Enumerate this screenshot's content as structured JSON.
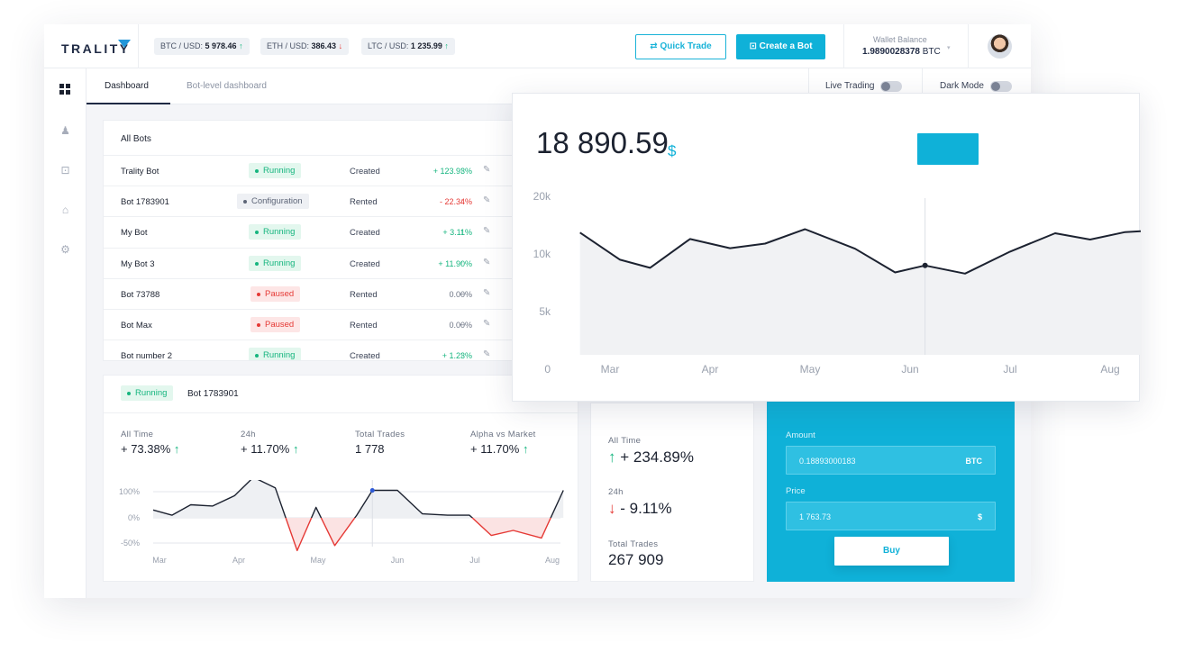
{
  "brand": {
    "name": "TRALITY"
  },
  "tickers": [
    {
      "label": "BTC / USD:",
      "value": "5 978.46",
      "arrow": "↑",
      "dir": "up"
    },
    {
      "label": "ETH / USD:",
      "value": "386.43",
      "arrow": "↓",
      "dir": "down"
    },
    {
      "label": "LTC / USD:",
      "value": "1 235.99",
      "arrow": "↑",
      "dir": "up"
    }
  ],
  "header": {
    "quick_trade_icon": "⇄",
    "quick_trade_label": "Quick Trade",
    "create_bot_icon": "⊡",
    "create_bot_label": "Create a Bot",
    "wallet_label": "Wallet Balance",
    "wallet_value": "1.9890028378",
    "wallet_unit": "BTC",
    "wallet_caret": "▾"
  },
  "sidebar": {
    "items": [
      {
        "name": "dashboard-grid-icon",
        "glyph": ""
      },
      {
        "name": "chess-piece-icon",
        "glyph": "♟"
      },
      {
        "name": "bot-icon",
        "glyph": "⊡"
      },
      {
        "name": "store-icon",
        "glyph": "⌂"
      },
      {
        "name": "settings-icon",
        "glyph": "⚙"
      }
    ]
  },
  "tabs": [
    {
      "label": "Dashboard",
      "active": true
    },
    {
      "label": "Bot-level dashboard",
      "active": false
    }
  ],
  "toggles": [
    {
      "label": "Live Trading"
    },
    {
      "label": "Dark Mode"
    }
  ],
  "bots": {
    "title": "All Bots",
    "edit_glyph": "✎",
    "rows": [
      {
        "name": "Trality Bot",
        "status": "Running",
        "status_key": "running",
        "type": "Created",
        "perf": "+ 123.93%",
        "arrow": "↑",
        "dir": "up"
      },
      {
        "name": "Bot 1783901",
        "status": "Configuration",
        "status_key": "configuration",
        "type": "Rented",
        "perf": "- 22.34%",
        "arrow": "↓",
        "dir": "down"
      },
      {
        "name": "My Bot",
        "status": "Running",
        "status_key": "running",
        "type": "Created",
        "perf": "+ 3.11%",
        "arrow": "↑",
        "dir": "up"
      },
      {
        "name": "My Bot 3",
        "status": "Running",
        "status_key": "running",
        "type": "Created",
        "perf": "+ 11.90%",
        "arrow": "↑",
        "dir": "up"
      },
      {
        "name": "Bot 73788",
        "status": "Paused",
        "status_key": "paused",
        "type": "Rented",
        "perf": "0.00%",
        "arrow": "–",
        "dir": "neutral"
      },
      {
        "name": "Bot Max",
        "status": "Paused",
        "status_key": "paused",
        "type": "Rented",
        "perf": "0.00%",
        "arrow": "–",
        "dir": "neutral"
      },
      {
        "name": "Bot number 2",
        "status": "Running",
        "status_key": "running",
        "type": "Created",
        "perf": "+ 1.23%",
        "arrow": "↑",
        "dir": "up"
      }
    ]
  },
  "detail": {
    "status": "Running",
    "title": "Bot 1783901",
    "stats": [
      {
        "label": "All Time",
        "value": "+ 73.38%",
        "arrow": "↑"
      },
      {
        "label": "24h",
        "value": "+ 11.70%",
        "arrow": "↑"
      },
      {
        "label": "Total Trades",
        "value": "1 778",
        "arrow": ""
      },
      {
        "label": "Alpha vs Market",
        "value": "+ 11.70%",
        "arrow": "↑"
      }
    ]
  },
  "summary": {
    "all_time_label": "All Time",
    "all_time_arrow": "↑",
    "all_time_value": "+ 234.89%",
    "day_label": "24h",
    "day_arrow": "↓",
    "day_value": "- 9.11%",
    "trades_label": "Total Trades",
    "trades_value": "267 909"
  },
  "trade": {
    "amount_label": "Amount",
    "amount_value": "0.18893000183",
    "amount_unit": "BTC",
    "price_label": "Price",
    "price_value": "1 763.73",
    "price_unit": "$",
    "buy_label": "Buy"
  },
  "popup": {
    "price": "18 890.59",
    "unit": "$"
  },
  "colors": {
    "accent": "#0fb1d8",
    "up": "#16b57f",
    "down": "#e53935",
    "line": "#1c2230",
    "area": "#f1f2f4"
  },
  "chart_data": [
    {
      "type": "area",
      "x": [
        "Mar",
        "",
        "Apr",
        "",
        "",
        "May",
        "",
        "",
        "Jun",
        "",
        "",
        "Jul",
        "",
        "",
        "Aug"
      ],
      "categories": [
        "Mar",
        "Apr",
        "May",
        "Jun",
        "Jul",
        "Aug"
      ],
      "yticks": [
        "0",
        "5k",
        "10k",
        "20k"
      ],
      "ylim": [
        0,
        20000
      ],
      "points": [
        [
          -0.3,
          13700
        ],
        [
          0.1,
          9500
        ],
        [
          0.4,
          8800
        ],
        [
          0.8,
          12600
        ],
        [
          1.2,
          11000
        ],
        [
          1.55,
          11800
        ],
        [
          1.95,
          14300
        ],
        [
          2.45,
          10900
        ],
        [
          2.85,
          8400
        ],
        [
          3.15,
          9000
        ],
        [
          3.55,
          8300
        ],
        [
          4.0,
          10400
        ],
        [
          4.45,
          13600
        ],
        [
          4.8,
          12500
        ],
        [
          5.15,
          13800
        ],
        [
          5.6,
          14200
        ],
        [
          6.0,
          8600
        ],
        [
          6.45,
          11500
        ],
        [
          6.9,
          15000
        ]
      ],
      "highlight_index": 9,
      "grid": false,
      "legend": "none"
    },
    {
      "type": "line",
      "categories": [
        "Mar",
        "Apr",
        "May",
        "Jun",
        "Jul",
        "Aug"
      ],
      "yticks": [
        "100%",
        "0%",
        "-50%"
      ],
      "ylim": [
        -50,
        100
      ],
      "points": [
        [
          0,
          30
        ],
        [
          0.3,
          10
        ],
        [
          0.6,
          50
        ],
        [
          0.95,
          45
        ],
        [
          1.3,
          85
        ],
        [
          1.6,
          155
        ],
        [
          1.95,
          115
        ],
        [
          2.3,
          -65
        ],
        [
          2.6,
          40
        ],
        [
          2.9,
          -55
        ],
        [
          3.25,
          10
        ],
        [
          3.5,
          105
        ],
        [
          3.9,
          105
        ],
        [
          4.3,
          15
        ],
        [
          4.7,
          10
        ],
        [
          5.05,
          10
        ],
        [
          5.4,
          -35
        ],
        [
          5.75,
          -25
        ],
        [
          6.2,
          -40
        ],
        [
          6.55,
          105
        ]
      ],
      "highlight_index": 11,
      "grid": true,
      "legend": "none"
    }
  ]
}
